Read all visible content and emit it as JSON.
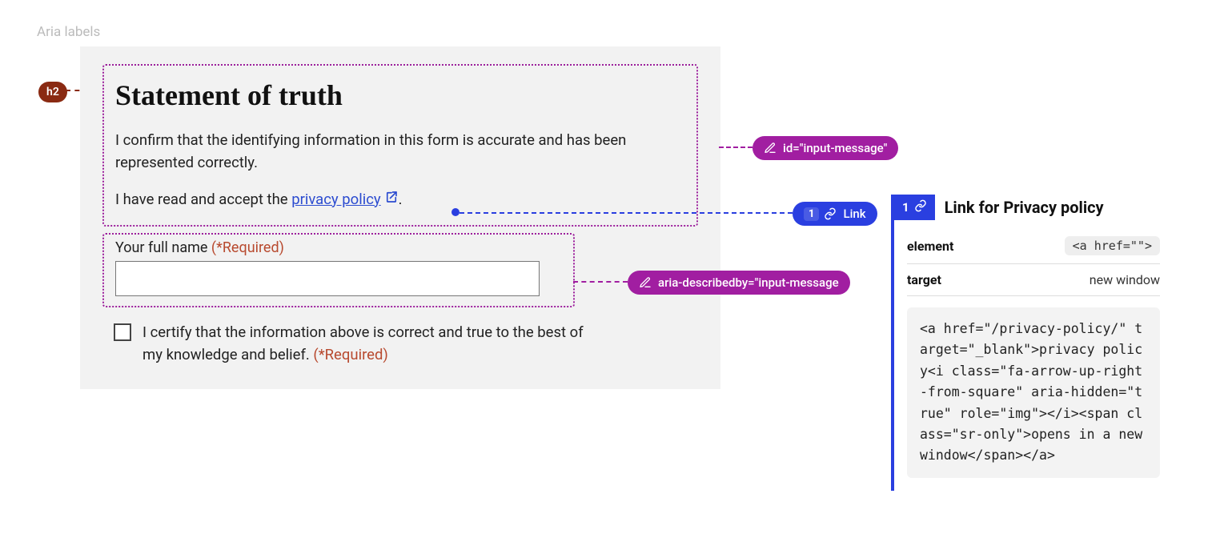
{
  "page_label": "Aria labels",
  "badges": {
    "h2": "h2",
    "id_msg": "id=\"input-message\"",
    "aria_desc": "aria-describedby=\"input-message",
    "link_num": "1",
    "link_label": "Link"
  },
  "form": {
    "heading": "Statement of truth",
    "confirm_text": "I confirm that the identifying information in this form is accurate and has been represented correctly.",
    "accept_prefix": "I have read and accept the ",
    "link_text": "privacy policy",
    "accept_suffix": ".",
    "fullname_label": "Your full name ",
    "required": "(*Required)",
    "certify_text": "I certify that the information above is correct and true to the best of my knowledge and belief. "
  },
  "panel": {
    "tab_num": "1",
    "title": "Link for Privacy policy",
    "rows": {
      "element_key": "element",
      "element_val": "<a href=\"\">",
      "target_key": "target",
      "target_val": "new window"
    },
    "code": "<a href=\"/privacy-policy/\" target=\"_blank\">privacy policy<i class=\"fa-arrow-up-right-from-square\" aria-hidden=\"true\" role=\"img\"></i><span class=\"sr-only\">opens in a new window</span></a>"
  }
}
